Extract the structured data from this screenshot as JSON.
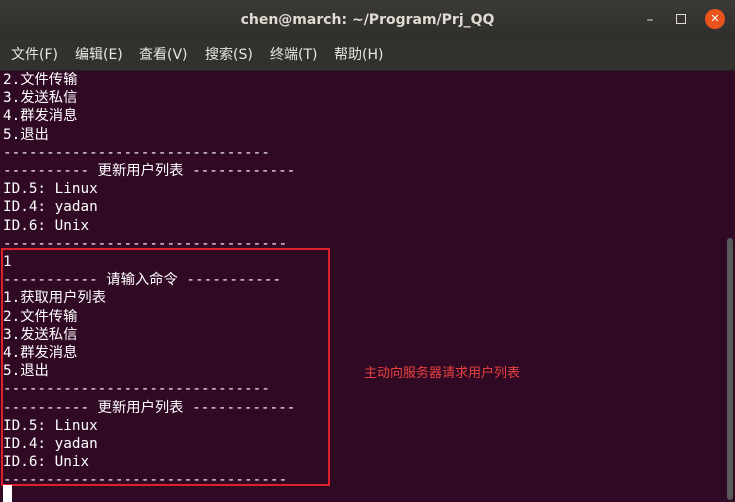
{
  "window": {
    "title": "chen@march: ~/Program/Prj_QQ",
    "controls": {
      "minimize": "–",
      "close": "✕"
    }
  },
  "menu": [
    {
      "label": "文件(F)"
    },
    {
      "label": "编辑(E)"
    },
    {
      "label": "查看(V)"
    },
    {
      "label": "搜索(S)"
    },
    {
      "label": "终端(T)"
    },
    {
      "label": "帮助(H)"
    }
  ],
  "terminal": {
    "lines": [
      "2.文件传输",
      "3.发送私信",
      "4.群发消息",
      "5.退出",
      "-------------------------------",
      "---------- 更新用户列表 ------------",
      "ID.5: Linux",
      "ID.4: yadan",
      "ID.6: Unix",
      "---------------------------------",
      "1",
      "----------- 请输入命令 -----------",
      "1.获取用户列表",
      "2.文件传输",
      "3.发送私信",
      "4.群发消息",
      "5.退出",
      "-------------------------------",
      "---------- 更新用户列表 ------------",
      "ID.5: Linux",
      "ID.4: yadan",
      "ID.6: Unix",
      "---------------------------------"
    ]
  },
  "annotation": {
    "text": "主动向服务器请求用户列表",
    "color": "#e84040"
  },
  "colors": {
    "terminal_bg": "#300a24",
    "highlight": "#e0202d",
    "close_button": "#e9531c"
  }
}
